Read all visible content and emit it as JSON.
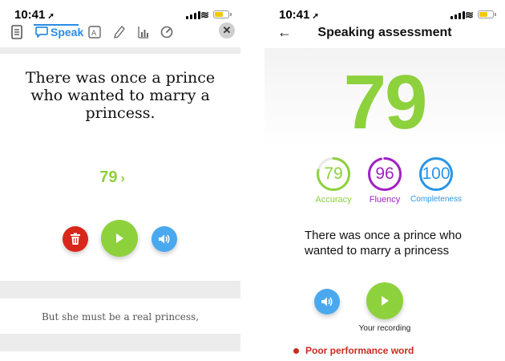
{
  "left": {
    "status_time": "10:41",
    "tabs": [
      {
        "icon": "document-icon"
      },
      {
        "icon": "speak-bubble-icon",
        "label": "Speak",
        "active": true
      },
      {
        "icon": "translate-icon"
      },
      {
        "icon": "pencil-icon"
      },
      {
        "icon": "bar-chart-icon"
      },
      {
        "icon": "speedometer-icon"
      }
    ],
    "speak_label": "Speak",
    "sentence": "There was once a prince who wanted to marry a princess.",
    "score": "79",
    "score_chevron": "›",
    "next_sentence": "But she must be a real princess,",
    "colors": {
      "accent": "#2b8ce6",
      "score": "#8dd13c",
      "delete": "#d9261c",
      "play": "#8dd13c",
      "audio": "#4aa8ee"
    }
  },
  "right": {
    "status_time": "10:41",
    "title": "Speaking assessment",
    "overall_score": "79",
    "metrics": [
      {
        "value": "79",
        "label": "Accuracy",
        "fraction": 0.79,
        "color": "#8dd13c"
      },
      {
        "value": "96",
        "label": "Fluency",
        "fraction": 0.96,
        "color": "#a21fc5"
      },
      {
        "value": "100",
        "label": "Completeness",
        "fraction": 1.0,
        "color": "#2b95e6"
      }
    ],
    "sentence": "There was once a prince who wanted to marry a princess",
    "recording_label": "Your recording",
    "legend_label": "Poor performance word",
    "colors": {
      "legend": "#cc2a1e"
    }
  }
}
